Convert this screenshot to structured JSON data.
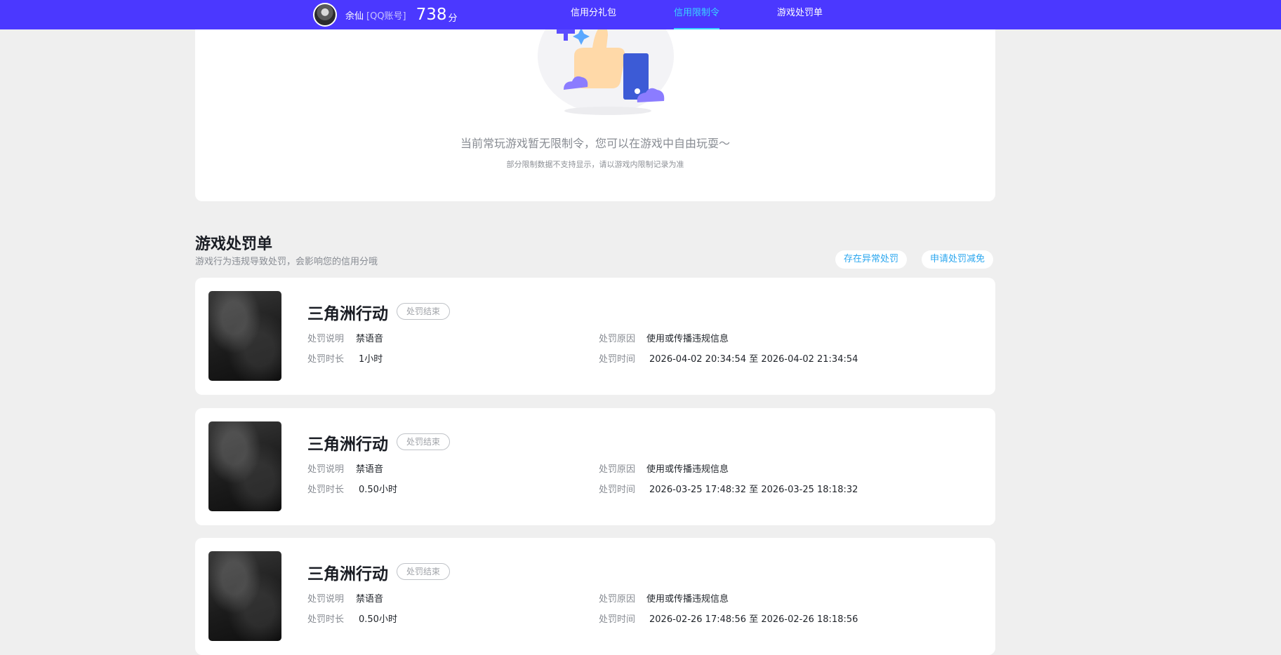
{
  "header": {
    "user_name": "余仙",
    "account_type": "[QQ账号]",
    "score": "738",
    "score_unit": "分",
    "nav": [
      {
        "label": "信用分礼包",
        "active": false
      },
      {
        "label": "信用限制令",
        "active": true
      },
      {
        "label": "游戏处罚单",
        "active": false
      }
    ],
    "colors": {
      "bar": "#4b38ff",
      "active": "#39d4ff"
    }
  },
  "restriction": {
    "empty_message": "当前常玩游戏暂无限制令，您可以在游戏中自由玩耍～",
    "note": "部分限制数据不支持显示，请以游戏内限制记录为准"
  },
  "penalty_section": {
    "title": "游戏处罚单",
    "description": "游戏行为违规导致处罚，会影响您的信用分哦",
    "buttons": {
      "abnormal": "存在异常处罚",
      "appeal": "申请处罚减免"
    },
    "labels": {
      "desc": "处罚说明",
      "duration": "处罚时长",
      "reason": "处罚原因",
      "time": "处罚时间"
    },
    "records": [
      {
        "game": "三角洲行动",
        "status": "处罚结束",
        "desc": "禁语音",
        "duration": "1小时",
        "reason": "使用或传播违规信息",
        "time": "2026-04-02 20:34:54 至 2026-04-02 21:34:54"
      },
      {
        "game": "三角洲行动",
        "status": "处罚结束",
        "desc": "禁语音",
        "duration": "0.50小时",
        "reason": "使用或传播违规信息",
        "time": "2026-03-25 17:48:32 至 2026-03-25 18:18:32"
      },
      {
        "game": "三角洲行动",
        "status": "处罚结束",
        "desc": "禁语音",
        "duration": "0.50小时",
        "reason": "使用或传播违规信息",
        "time": "2026-02-26 17:48:56 至 2026-02-26 18:18:56"
      }
    ]
  }
}
